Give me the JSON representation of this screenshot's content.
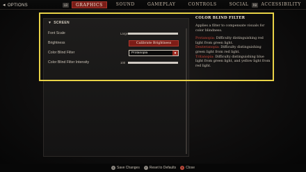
{
  "header": {
    "back_label": "OPTIONS",
    "back_arrow": "◂",
    "left_key": "LB",
    "right_key": "RB",
    "tabs": [
      {
        "label": "GRAPHICS",
        "active": true
      },
      {
        "label": "SOUND",
        "active": false
      },
      {
        "label": "GAMEPLAY",
        "active": false
      },
      {
        "label": "CONTROLS",
        "active": false
      },
      {
        "label": "SOCIAL",
        "active": false
      },
      {
        "label": "ACCESSIBILITY",
        "active": false
      }
    ]
  },
  "settings": {
    "section_title": "SCREEN",
    "font_scale": {
      "label": "Font Scale",
      "value": "Large",
      "fill_fraction": 1.0
    },
    "brightness": {
      "label": "Brightness",
      "button_label": "Calibrate Brightness"
    },
    "color_blind_filter": {
      "label": "Color Blind Filter",
      "selected": "Protanopia",
      "chevron": "▼"
    },
    "filter_intensity": {
      "label": "Color Blind Filter Intensity",
      "value": "100",
      "fill_fraction": 1.0
    }
  },
  "description": {
    "title": "COLOR BLIND FILTER",
    "intro": "Applies a filter to compensate visuals for color blindness.",
    "items": [
      {
        "term": "Protanopia:",
        "text": " Difficulty distinguishing red light from green light."
      },
      {
        "term": "Deuteranopia:",
        "text": " Difficulty distinguishing green light from red light."
      },
      {
        "term": "Tritanopia:",
        "text": " Difficulty distinguishing blue light from green light, and yellow light from red light."
      }
    ]
  },
  "footer": {
    "actions": [
      {
        "key": "A",
        "label": "Save Changes"
      },
      {
        "key": "Y",
        "label": "Reset to Defaults"
      },
      {
        "key": "B",
        "label": "Close"
      }
    ]
  },
  "colors": {
    "accent_red": "#7a1d17",
    "highlight_frame": "#e9d347",
    "term_red": "#d0483a"
  }
}
